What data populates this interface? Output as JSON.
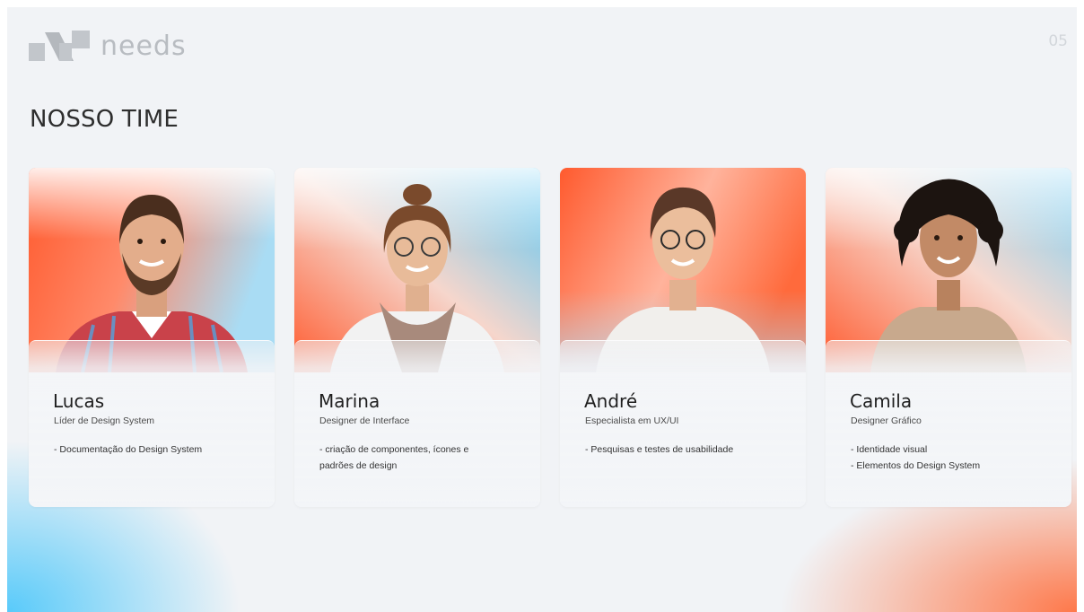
{
  "brand": {
    "name": "needs",
    "logo_icon": "needs-logo-icon"
  },
  "page_number": "05",
  "title": "NOSSO TIME",
  "colors": {
    "accent_orange": "#ff5a2e",
    "accent_blue": "#5bc8f5",
    "background": "#f1f3f6"
  },
  "team": [
    {
      "name": "Lucas",
      "role": "Líder de Design System",
      "tasks": [
        "- Documentação do Design System"
      ]
    },
    {
      "name": "Marina",
      "role": "Designer de Interface",
      "tasks": [
        "- criação de componentes, ícones e",
        "padrões de design"
      ]
    },
    {
      "name": "André",
      "role": "Especialista em UX/UI",
      "tasks": [
        "- Pesquisas e testes de usabilidade"
      ]
    },
    {
      "name": "Camila",
      "role": "Designer Gráfico",
      "tasks": [
        "- Identidade visual",
        "- Elementos do Design System"
      ]
    }
  ]
}
